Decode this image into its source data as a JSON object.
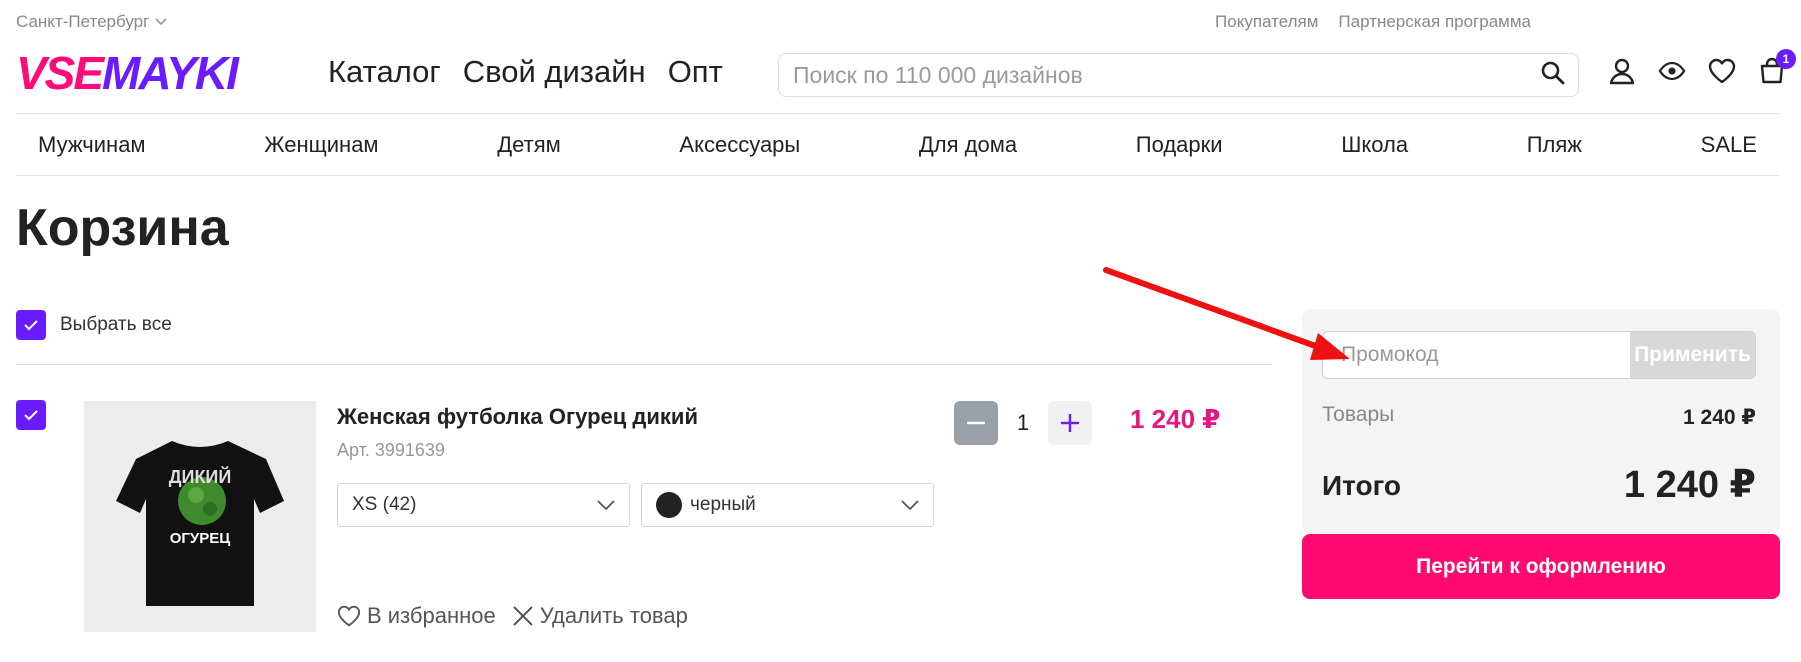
{
  "topbar": {
    "city": "Санкт-Петербург",
    "links": [
      "Покупателям",
      "Партнерская программа"
    ]
  },
  "header": {
    "logo_part1": "VSE",
    "logo_part2": "MAYKI",
    "nav": [
      "Каталог",
      "Свой дизайн",
      "Опт"
    ],
    "search_placeholder": "Поиск по 110 000 дизайнов",
    "cart_count": "1",
    "icons": [
      "search-icon",
      "user-icon",
      "eye-icon",
      "heart-icon",
      "bag-icon"
    ]
  },
  "categories": [
    "Мужчинам",
    "Женщинам",
    "Детям",
    "Аксессуары",
    "Для дома",
    "Подарки",
    "Школа",
    "Пляж",
    "SALE"
  ],
  "page_title": "Корзина",
  "select_all_label": "Выбрать все",
  "item": {
    "name": "Женская футболка Огурец дикий",
    "article": "Арт. 3991639",
    "size": "XS (42)",
    "color": "черный",
    "quantity": "1",
    "price": "1 240 ₽",
    "favorite_label": "В избранное",
    "delete_label": "Удалить товар",
    "print_lines": [
      "ДИКИЙ",
      "ОГУРЕЦ"
    ]
  },
  "summary": {
    "promo_placeholder": "Промокод",
    "apply_label": "Применить",
    "goods_label": "Товары",
    "goods_value": "1 240 ₽",
    "total_label": "Итого",
    "total_value": "1 240 ₽",
    "checkout_label": "Перейти к оформлению"
  },
  "colors": {
    "brand_pink": "#ff0a7a",
    "brand_purple": "#6a1bff",
    "price_pink": "#e8157e",
    "arrow_red": "#ee1111"
  }
}
